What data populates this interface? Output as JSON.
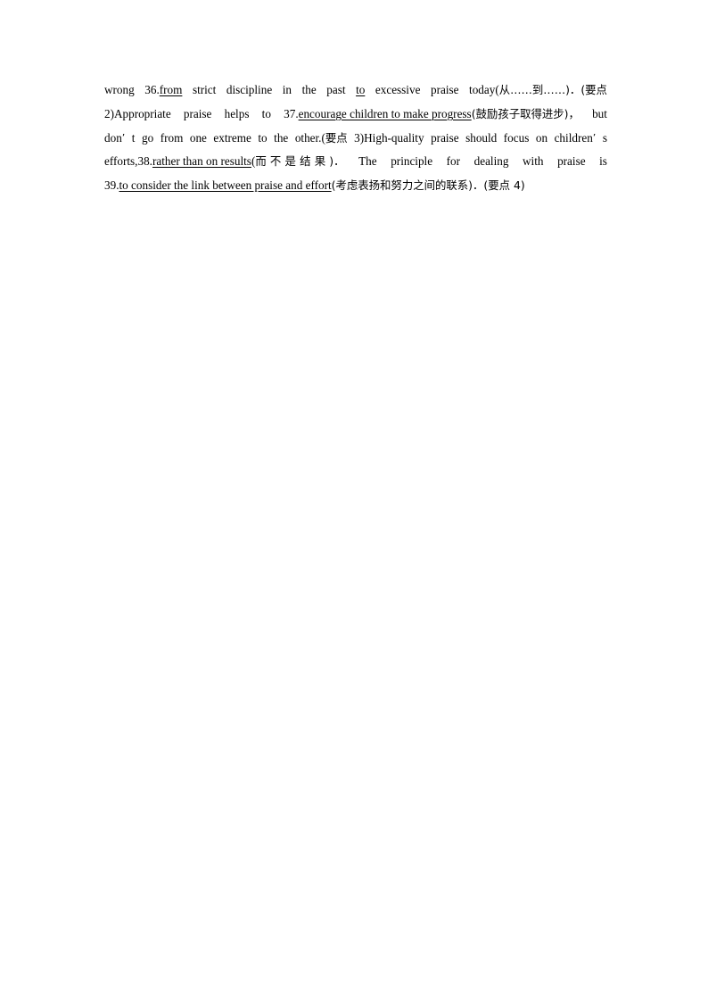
{
  "document": {
    "type": "exam-answer-key-page",
    "language_mix": "english-chinese",
    "page_background": "#ffffff",
    "text_color": "#000000",
    "lines": [
      {
        "id": "line-1",
        "segments": [
          {
            "text": "wrong",
            "underline": false,
            "script": "latin"
          },
          {
            "text": "36.",
            "underline": false,
            "script": "latin"
          },
          {
            "text": "from",
            "underline": true,
            "script": "latin"
          },
          {
            "text": "strict",
            "underline": false,
            "script": "latin"
          },
          {
            "text": "discipline",
            "underline": false,
            "script": "latin"
          },
          {
            "text": "in",
            "underline": false,
            "script": "latin"
          },
          {
            "text": "the",
            "underline": false,
            "script": "latin"
          },
          {
            "text": "past",
            "underline": false,
            "script": "latin"
          },
          {
            "text": "to",
            "underline": true,
            "script": "latin"
          },
          {
            "text": "excessive",
            "underline": false,
            "script": "latin"
          },
          {
            "text": "praise",
            "underline": false,
            "script": "latin"
          },
          {
            "text": "today(",
            "underline": false,
            "script": "latin"
          },
          {
            "text": "从……到……",
            "underline": false,
            "script": "han"
          },
          {
            "text": ")．(",
            "underline": false,
            "script": "han"
          },
          {
            "text": "要点",
            "underline": false,
            "script": "han"
          }
        ],
        "plain": "wrong 36.from strict discipline in the past to excessive praise today(从……到……)．(要点"
      },
      {
        "id": "line-2",
        "segments": [
          {
            "text": "2)Appropriate",
            "underline": false,
            "script": "latin"
          },
          {
            "text": "praise",
            "underline": false,
            "script": "latin"
          },
          {
            "text": "helps",
            "underline": false,
            "script": "latin"
          },
          {
            "text": "to",
            "underline": false,
            "script": "latin"
          },
          {
            "text": "37.",
            "underline": false,
            "script": "latin"
          },
          {
            "text": "encourage children to make progress",
            "underline": true,
            "script": "latin"
          },
          {
            "text": "(鼓励孩子取得进步)，",
            "underline": false,
            "script": "han"
          },
          {
            "text": "but",
            "underline": false,
            "script": "latin"
          }
        ],
        "plain": "2)Appropriate praise helps to 37.encourage children to make progress(鼓励孩子取得进步)，but"
      },
      {
        "id": "line-3",
        "segments": [
          {
            "text": "don",
            "underline": false,
            "script": "latin"
          },
          {
            "text": "’",
            "underline": false,
            "script": "han"
          },
          {
            "text": "t",
            "underline": false,
            "script": "latin"
          },
          {
            "text": "go",
            "underline": false,
            "script": "latin"
          },
          {
            "text": "from",
            "underline": false,
            "script": "latin"
          },
          {
            "text": "one",
            "underline": false,
            "script": "latin"
          },
          {
            "text": "extreme",
            "underline": false,
            "script": "latin"
          },
          {
            "text": "to",
            "underline": false,
            "script": "latin"
          },
          {
            "text": "the",
            "underline": false,
            "script": "latin"
          },
          {
            "text": "other.(",
            "underline": false,
            "script": "latin"
          },
          {
            "text": "要点",
            "underline": false,
            "script": "han"
          },
          {
            "text": "3)High-quality",
            "underline": false,
            "script": "latin"
          },
          {
            "text": "praise",
            "underline": false,
            "script": "latin"
          },
          {
            "text": "should",
            "underline": false,
            "script": "latin"
          },
          {
            "text": "focus",
            "underline": false,
            "script": "latin"
          },
          {
            "text": "on",
            "underline": false,
            "script": "latin"
          },
          {
            "text": "children",
            "underline": false,
            "script": "latin"
          },
          {
            "text": "’",
            "underline": false,
            "script": "han"
          },
          {
            "text": "s",
            "underline": false,
            "script": "latin"
          }
        ],
        "plain": "don’ t go from one extreme to the other.(要点 3)High-quality praise should focus on children’ s"
      },
      {
        "id": "line-4",
        "segments": [
          {
            "text": "efforts,38.",
            "underline": false,
            "script": "latin"
          },
          {
            "text": "rather than on results",
            "underline": true,
            "script": "latin"
          },
          {
            "text": "(",
            "underline": false,
            "script": "latin"
          },
          {
            "text": "而不是结果",
            "underline": false,
            "script": "han"
          },
          {
            "text": ")．",
            "underline": false,
            "script": "han"
          },
          {
            "text": "The",
            "underline": false,
            "script": "latin"
          },
          {
            "text": "principle",
            "underline": false,
            "script": "latin"
          },
          {
            "text": "for",
            "underline": false,
            "script": "latin"
          },
          {
            "text": "dealing",
            "underline": false,
            "script": "latin"
          },
          {
            "text": "with",
            "underline": false,
            "script": "latin"
          },
          {
            "text": "praise",
            "underline": false,
            "script": "latin"
          },
          {
            "text": "is",
            "underline": false,
            "script": "latin"
          }
        ],
        "plain": "efforts,38.rather than on results(而不是结果)．The principle for dealing with praise is"
      },
      {
        "id": "line-5",
        "segments": [
          {
            "text": "39.",
            "underline": false,
            "script": "latin"
          },
          {
            "text": "to consider the link between praise and effort",
            "underline": true,
            "script": "latin"
          },
          {
            "text": "(考虑表扬和努力之间的联系)．(要点 4)",
            "underline": false,
            "script": "han"
          }
        ],
        "plain": "39.to consider the link between praise and effort(考虑表扬和努力之间的联系)．(要点 4)"
      }
    ],
    "answers": [
      {
        "number": "36.",
        "answer": "from"
      },
      {
        "number": "37.",
        "answer": "encourage children to make progress",
        "gloss": "鼓励孩子取得进步"
      },
      {
        "number": "38.",
        "answer": "rather than on results",
        "gloss": "而不是结果"
      },
      {
        "number": "39.",
        "answer": "to consider the link between praise and effort",
        "gloss": "考虑表扬和努力之间的联系"
      }
    ],
    "key_point_markers": [
      "要点 2)",
      "要点 3)",
      "要点 4)"
    ]
  }
}
